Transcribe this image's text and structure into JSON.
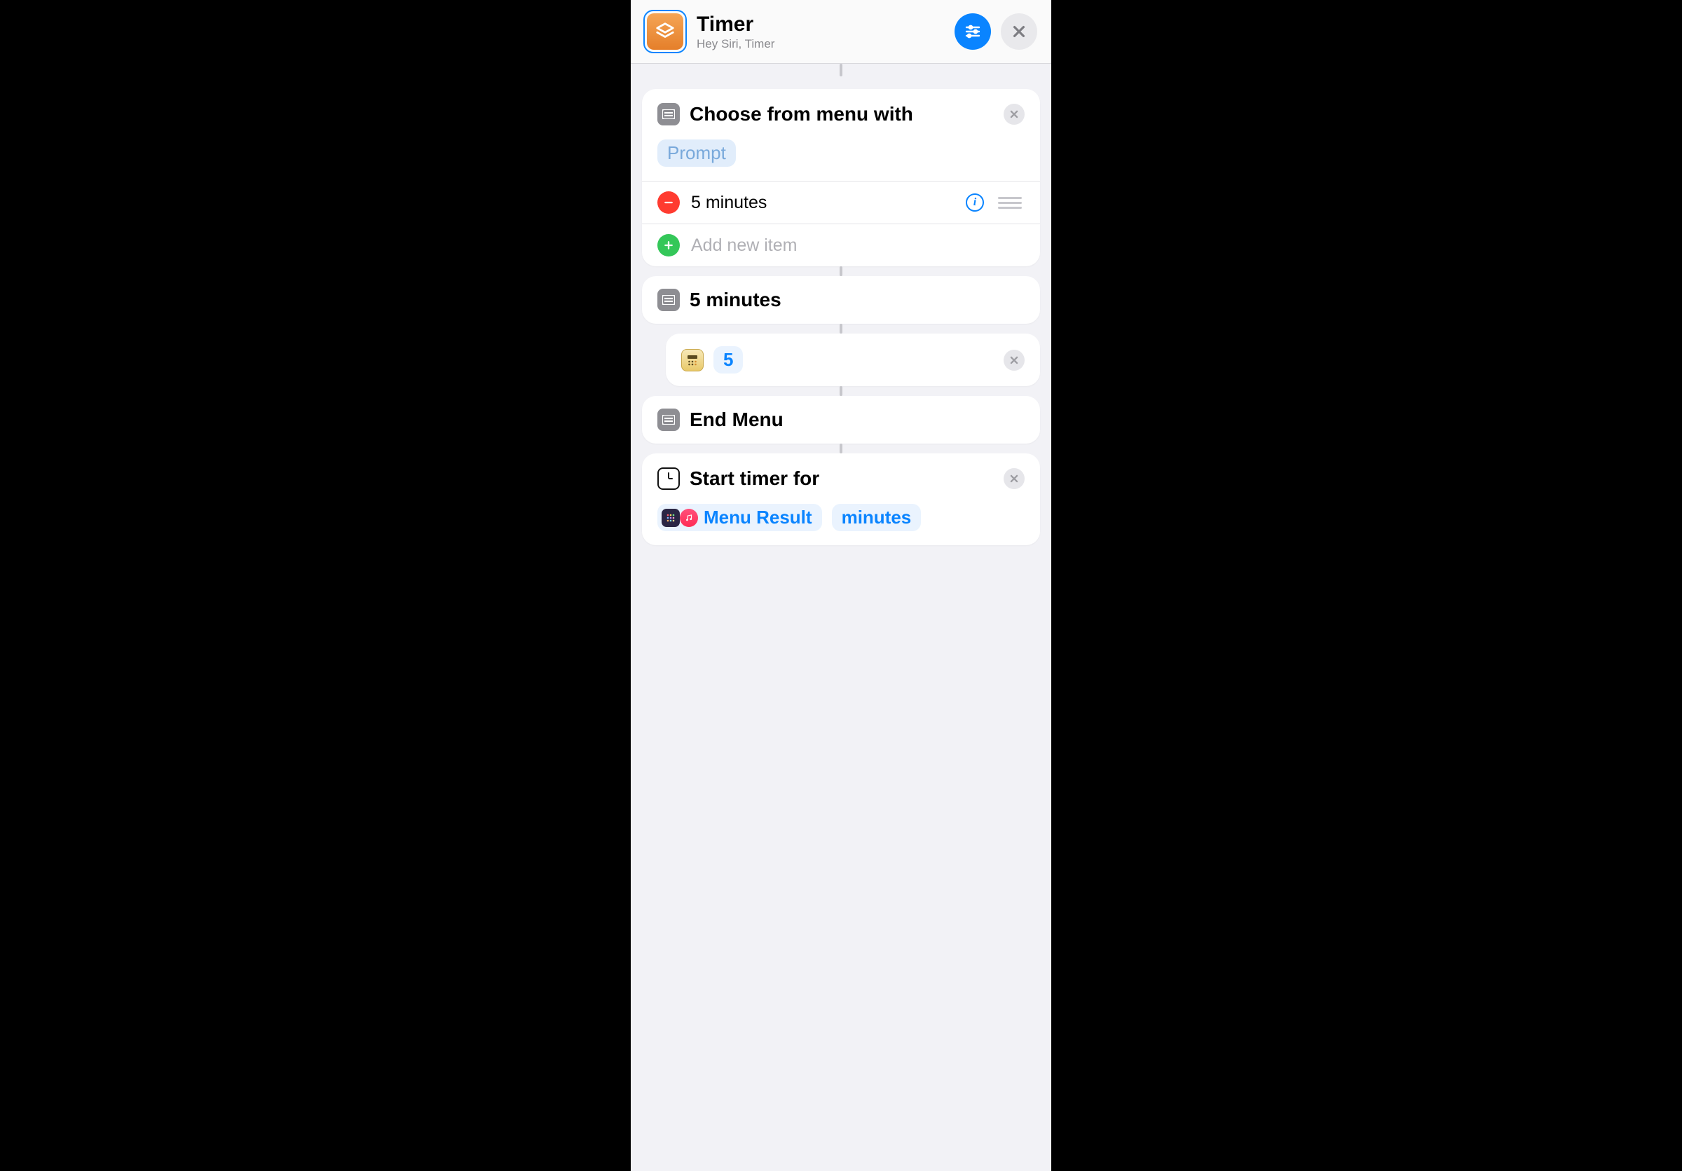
{
  "header": {
    "title": "Timer",
    "subtitle": "Hey Siri, Timer"
  },
  "actions": {
    "choose": {
      "label": "Choose from menu with",
      "prompt_token": "Prompt",
      "items": [
        "5 minutes"
      ],
      "add_placeholder": "Add new item"
    },
    "case1": {
      "label": "5 minutes"
    },
    "number": {
      "value": "5"
    },
    "end": {
      "label": "End Menu"
    },
    "timer": {
      "prefix": "Start timer for",
      "variable": "Menu Result",
      "unit": "minutes"
    }
  }
}
